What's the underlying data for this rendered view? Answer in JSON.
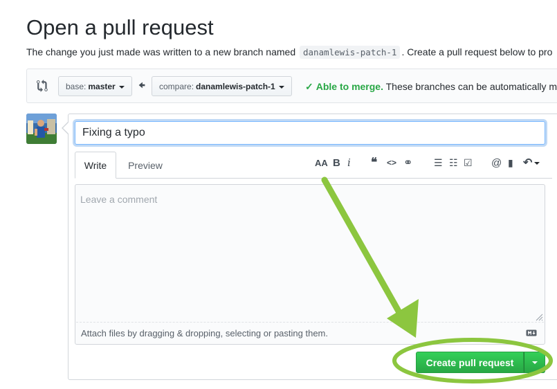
{
  "page": {
    "title": "Open a pull request",
    "description_before": "The change you just made was written to a new branch named",
    "branch_name": "danamlewis-patch-1",
    "description_after": ". Create a pull request below to pro"
  },
  "compare_bar": {
    "base_label": "base:",
    "base_value": "master",
    "compare_label": "compare:",
    "compare_value": "danamlewis-patch-1",
    "merge_status": "Able to merge.",
    "merge_detail": "These branches can be automatically m",
    "icons": [
      "git-compare-icon",
      "arrow-left-icon",
      "check-icon"
    ]
  },
  "form": {
    "title_value": "Fixing a typo",
    "tabs": [
      {
        "label": "Write",
        "active": true
      },
      {
        "label": "Preview",
        "active": false
      }
    ],
    "toolbar": {
      "heading": "AA",
      "bold": "B",
      "italic": "i",
      "quote": "❝",
      "code": "<>",
      "link": "⚭",
      "unordered_list": "☰",
      "ordered_list": "☷",
      "task_list": "☑",
      "mention": "@",
      "saved_reply": "▮",
      "reply": "↶"
    },
    "comment_placeholder": "Leave a comment",
    "attach_text": "Attach files by dragging & dropping, selecting or pasting them.",
    "submit_label": "Create pull request"
  },
  "colors": {
    "accent_green": "#28a745",
    "annotation_green": "#8cc63f",
    "focus_blue": "#79b8ff"
  }
}
